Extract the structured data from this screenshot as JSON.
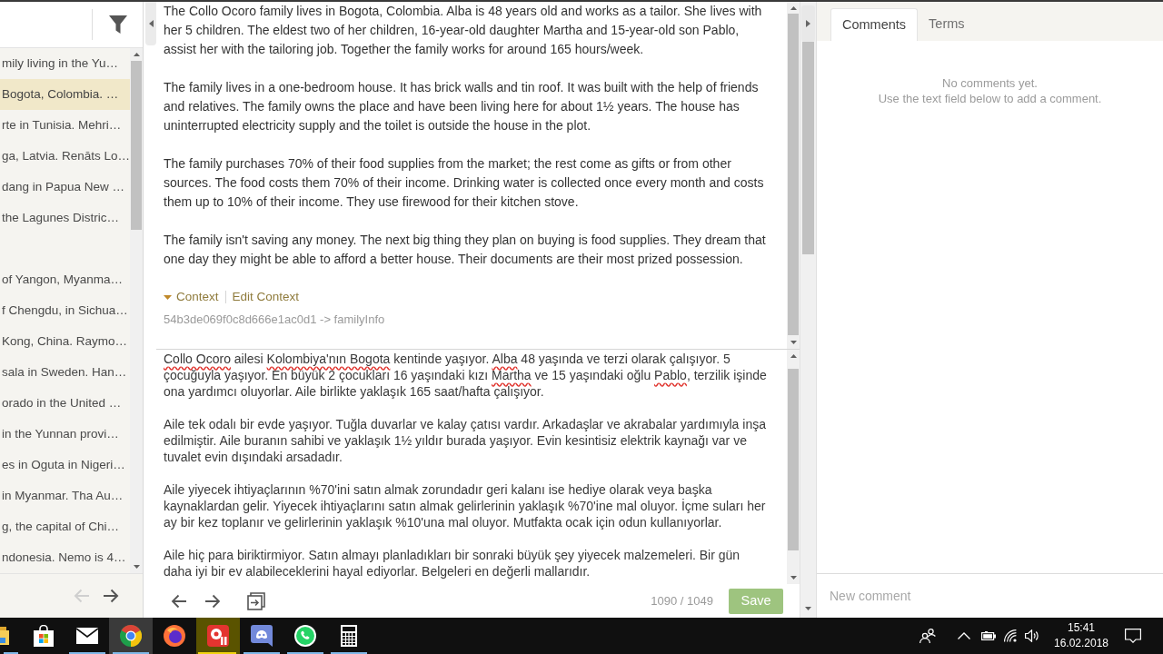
{
  "sidebar": {
    "items": [
      {
        "label": "mily living in the Yu…",
        "selected": false
      },
      {
        "label": "Bogota, Colombia. …",
        "selected": true
      },
      {
        "label": "rte in Tunisia. Mehri…",
        "selected": false
      },
      {
        "label": "ga, Latvia. Renāts Lo…",
        "selected": false
      },
      {
        "label": "dang in Papua New …",
        "selected": false
      },
      {
        "label": "the Lagunes Distric…",
        "selected": false
      },
      {
        "selected": false
      },
      {
        "label": "of Yangon, Myanma…",
        "selected": false
      },
      {
        "label": "f Chengdu, in Sichua…",
        "selected": false
      },
      {
        "label": "Kong, China. Raymo…",
        "selected": false
      },
      {
        "label": "sala in Sweden. Han…",
        "selected": false
      },
      {
        "label": "orado in the United …",
        "selected": false
      },
      {
        "label": "in the Yunnan provi…",
        "selected": false
      },
      {
        "label": "es in Oguta in Nigeri…",
        "selected": false
      },
      {
        "label": "in Myanmar. Tha Au…",
        "selected": false
      },
      {
        "label": "g, the capital of Chi…",
        "selected": false
      },
      {
        "label": "ndonesia. Nemo is 4…",
        "selected": false
      }
    ],
    "nav_buttons": [
      {
        "kind": "previous",
        "disabled": true
      },
      {
        "kind": "next",
        "disabled": false
      }
    ]
  },
  "source": {
    "paragraphs": [
      "The Collo Ocoro family lives in Bogota, Colombia. Alba is 48 years old and works as a tailor. She lives with her 5 children. The eldest two of her children, 16-year-old daughter Martha and 15-year-old son Pablo, assist her with the tailoring job. Together the family works for around 165 hours/week.",
      "The family lives in a one-bedroom house. It has brick walls and tin roof. It was built with the help of friends and relatives. The family owns the place and have been living here for about 1½ years. The house has uninterrupted electricity supply and the toilet is outside the house in the plot.",
      "The family purchases 70% of their food supplies from the market; the rest come as gifts or from other sources. The food costs them 70% of their income. Drinking water is collected once every month and costs them up to 10% of their income. They use firewood for their kitchen stove.",
      "The family isn't saving any money. The next big thing they plan on buying is food supplies. They dream that one day they might be able to afford a better house. Their documents are their most prized possession."
    ],
    "context": {
      "toggle_label": "Context",
      "expanded": true,
      "edit_label": "Edit Context"
    },
    "key": "54b3de069f0c8d666e1ac0d1 -> familyInfo"
  },
  "translation": {
    "paragraphs": [
      {
        "segments": [
          {
            "text": "Collo Ocoro",
            "misspelled": true
          },
          {
            "text": " ailesi ",
            "misspelled": false
          },
          {
            "text": "Kolombiya'nın Bogota",
            "misspelled": true
          },
          {
            "text": " kentinde yaşıyor. ",
            "misspelled": false
          },
          {
            "text": "Alba",
            "misspelled": true
          },
          {
            "text": " 48 yaşında ve terzi olarak çalışıyor. 5 çocuğuyla yaşıyor. En büyük 2 çocukları 16 yaşındaki kızı ",
            "misspelled": false
          },
          {
            "text": "Martha",
            "misspelled": true
          },
          {
            "text": " ve 15 yaşındaki oğlu ",
            "misspelled": false
          },
          {
            "text": "Pablo",
            "misspelled": true
          },
          {
            "text": ", terzilik işinde ona yardımcı oluyorlar. Aile birlikte yaklaşık 165 saat/hafta çalışıyor.",
            "misspelled": false
          }
        ]
      },
      {
        "segments": [
          {
            "text": "Aile tek odalı bir evde yaşıyor. Tuğla duvarlar ve kalay çatısı vardır. Arkadaşlar ve akrabalar yardımıyla inşa edilmiştir. Aile buranın sahibi ve yaklaşık 1½ yıldır burada yaşıyor. Evin kesintisiz elektrik kaynağı var ve tuvalet evin dışındaki arsadadır.",
            "misspelled": false
          }
        ]
      },
      {
        "segments": [
          {
            "text": "Aile yiyecek ihtiyaçlarının %70'ini satın almak zorundadır geri kalanı ise hediye olarak veya başka kaynaklardan gelir. Yiyecek ihtiyaçlarını satın almak gelirlerinin yaklaşık %70'ine mal oluyor. İçme suları her ay bir kez toplanır ve gelirlerinin yaklaşık %10'una mal oluyor. Mutfakta ocak için odun kullanıyorlar.",
            "misspelled": false
          }
        ]
      },
      {
        "segments": [
          {
            "text": "Aile hiç para biriktirmiyor. Satın almayı planladıkları bir sonraki büyük şey yiyecek malzemeleri. Bir gün daha iyi bir ev alabileceklerini hayal ediyorlar. Belgeleri en değerli mallarıdır.",
            "misspelled": false
          }
        ]
      }
    ],
    "counter": "1090 / 1049",
    "save_label": "Save"
  },
  "side_panel": {
    "tabs": [
      {
        "label": "Comments",
        "selected": true
      },
      {
        "label": "Terms",
        "selected": false
      }
    ],
    "empty_message": [
      "No comments yet.",
      "Use the text field below to add a comment."
    ],
    "comment_field": {
      "placeholder": "New comment"
    }
  },
  "taskbar": {
    "apps": [
      {
        "kind": "folder",
        "open": true,
        "selected": false,
        "attention": false
      },
      {
        "kind": "store",
        "open": false,
        "selected": false,
        "attention": false
      },
      {
        "kind": "mail",
        "open": true,
        "selected": false,
        "attention": false
      },
      {
        "kind": "chrome",
        "open": true,
        "selected": true,
        "attention": false
      },
      {
        "kind": "firefox",
        "open": false,
        "selected": false,
        "attention": false
      },
      {
        "kind": "redapp",
        "open": true,
        "selected": false,
        "attention": true
      },
      {
        "kind": "discord",
        "open": true,
        "selected": false,
        "attention": false
      },
      {
        "kind": "whatsapp",
        "open": true,
        "selected": false,
        "attention": false
      },
      {
        "kind": "calculator",
        "open": true,
        "selected": false,
        "attention": false
      }
    ],
    "clock": {
      "time": "15:41",
      "date": "16.02.2018"
    }
  }
}
